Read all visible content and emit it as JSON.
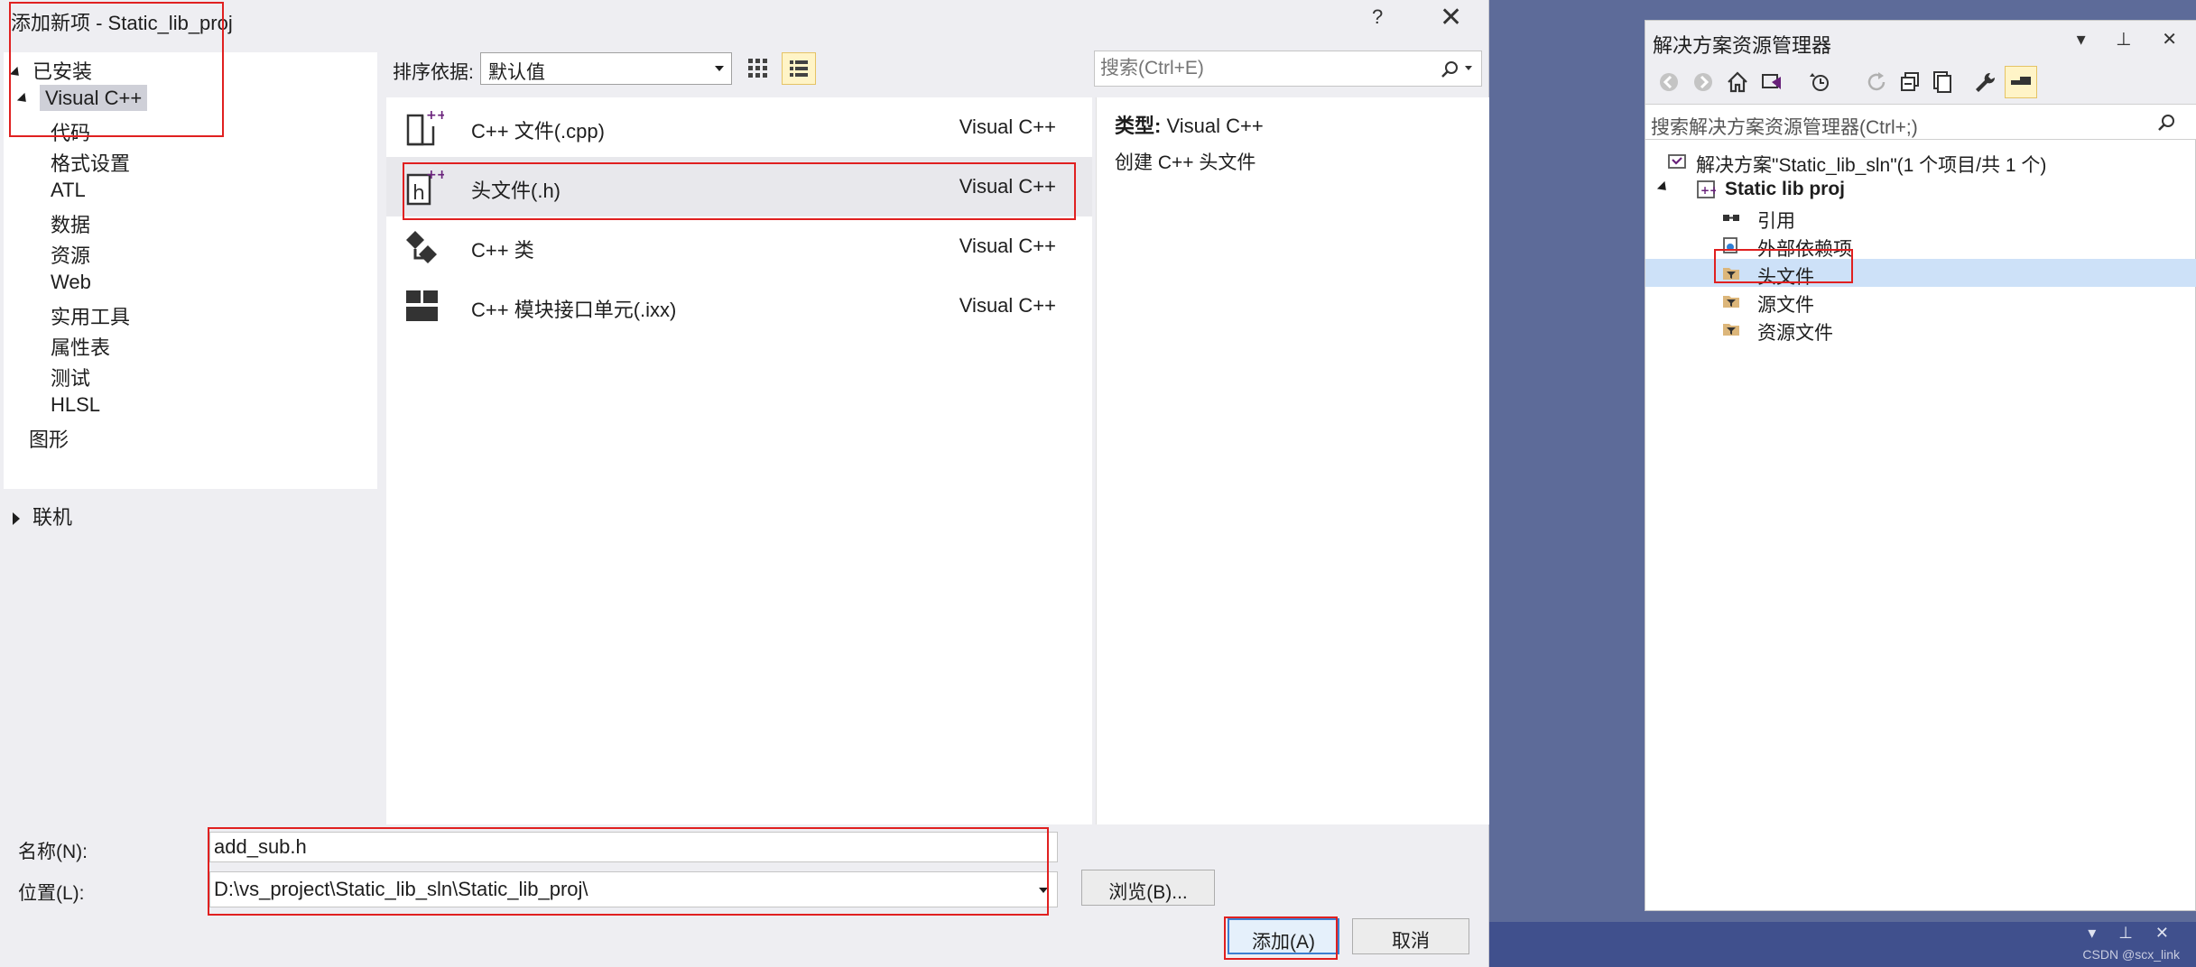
{
  "dialog": {
    "title": "添加新项 - Static_lib_proj",
    "help": "?",
    "close": "✕"
  },
  "left_tree": {
    "installed": "已安装",
    "visual_cpp": "Visual C++",
    "children": [
      "代码",
      "格式设置",
      "ATL",
      "数据",
      "资源",
      "Web",
      "实用工具",
      "属性表",
      "测试",
      "HLSL"
    ],
    "graphics": "图形",
    "online": "联机"
  },
  "toolbar": {
    "sort_label": "排序依据:",
    "sort_value": "默认值",
    "search_placeholder": "搜索(Ctrl+E)"
  },
  "templates": [
    {
      "name": "C++ 文件(.cpp)",
      "lang": "Visual C++",
      "icon": "cpp-file-icon"
    },
    {
      "name": "头文件(.h)",
      "lang": "Visual C++",
      "icon": "header-file-icon"
    },
    {
      "name": "C++ 类",
      "lang": "Visual C++",
      "icon": "cpp-class-icon"
    },
    {
      "name": "C++ 模块接口单元(.ixx)",
      "lang": "Visual C++",
      "icon": "module-interface-icon"
    }
  ],
  "details": {
    "type_label": "类型:",
    "type_value": "Visual C++",
    "description": "创建 C++ 头文件"
  },
  "form": {
    "name_label": "名称(N):",
    "name_value": "add_sub.h",
    "location_label": "位置(L):",
    "location_value": "D:\\vs_project\\Static_lib_sln\\Static_lib_proj\\",
    "browse": "浏览(B)...",
    "add": "添加(A)",
    "cancel": "取消"
  },
  "solution_explorer": {
    "title": "解决方案资源管理器",
    "header_icons": "▾ ⊥ ✕",
    "search_placeholder": "搜索解决方案资源管理器(Ctrl+;)",
    "solution": "解决方案\"Static_lib_sln\"(1 个项目/共 1 个)",
    "project": "Static lib proj",
    "items": [
      "引用",
      "外部依赖项",
      "头文件",
      "源文件",
      "资源文件"
    ]
  },
  "watermark": "CSDN @scx_link",
  "strip_icons": "▾ ⊥ ✕",
  "colors": {
    "accent": "#68217a",
    "highlight_red": "#e02020",
    "selection_blue": "#cde1f8",
    "folder_yellow": "#dcb67a"
  }
}
